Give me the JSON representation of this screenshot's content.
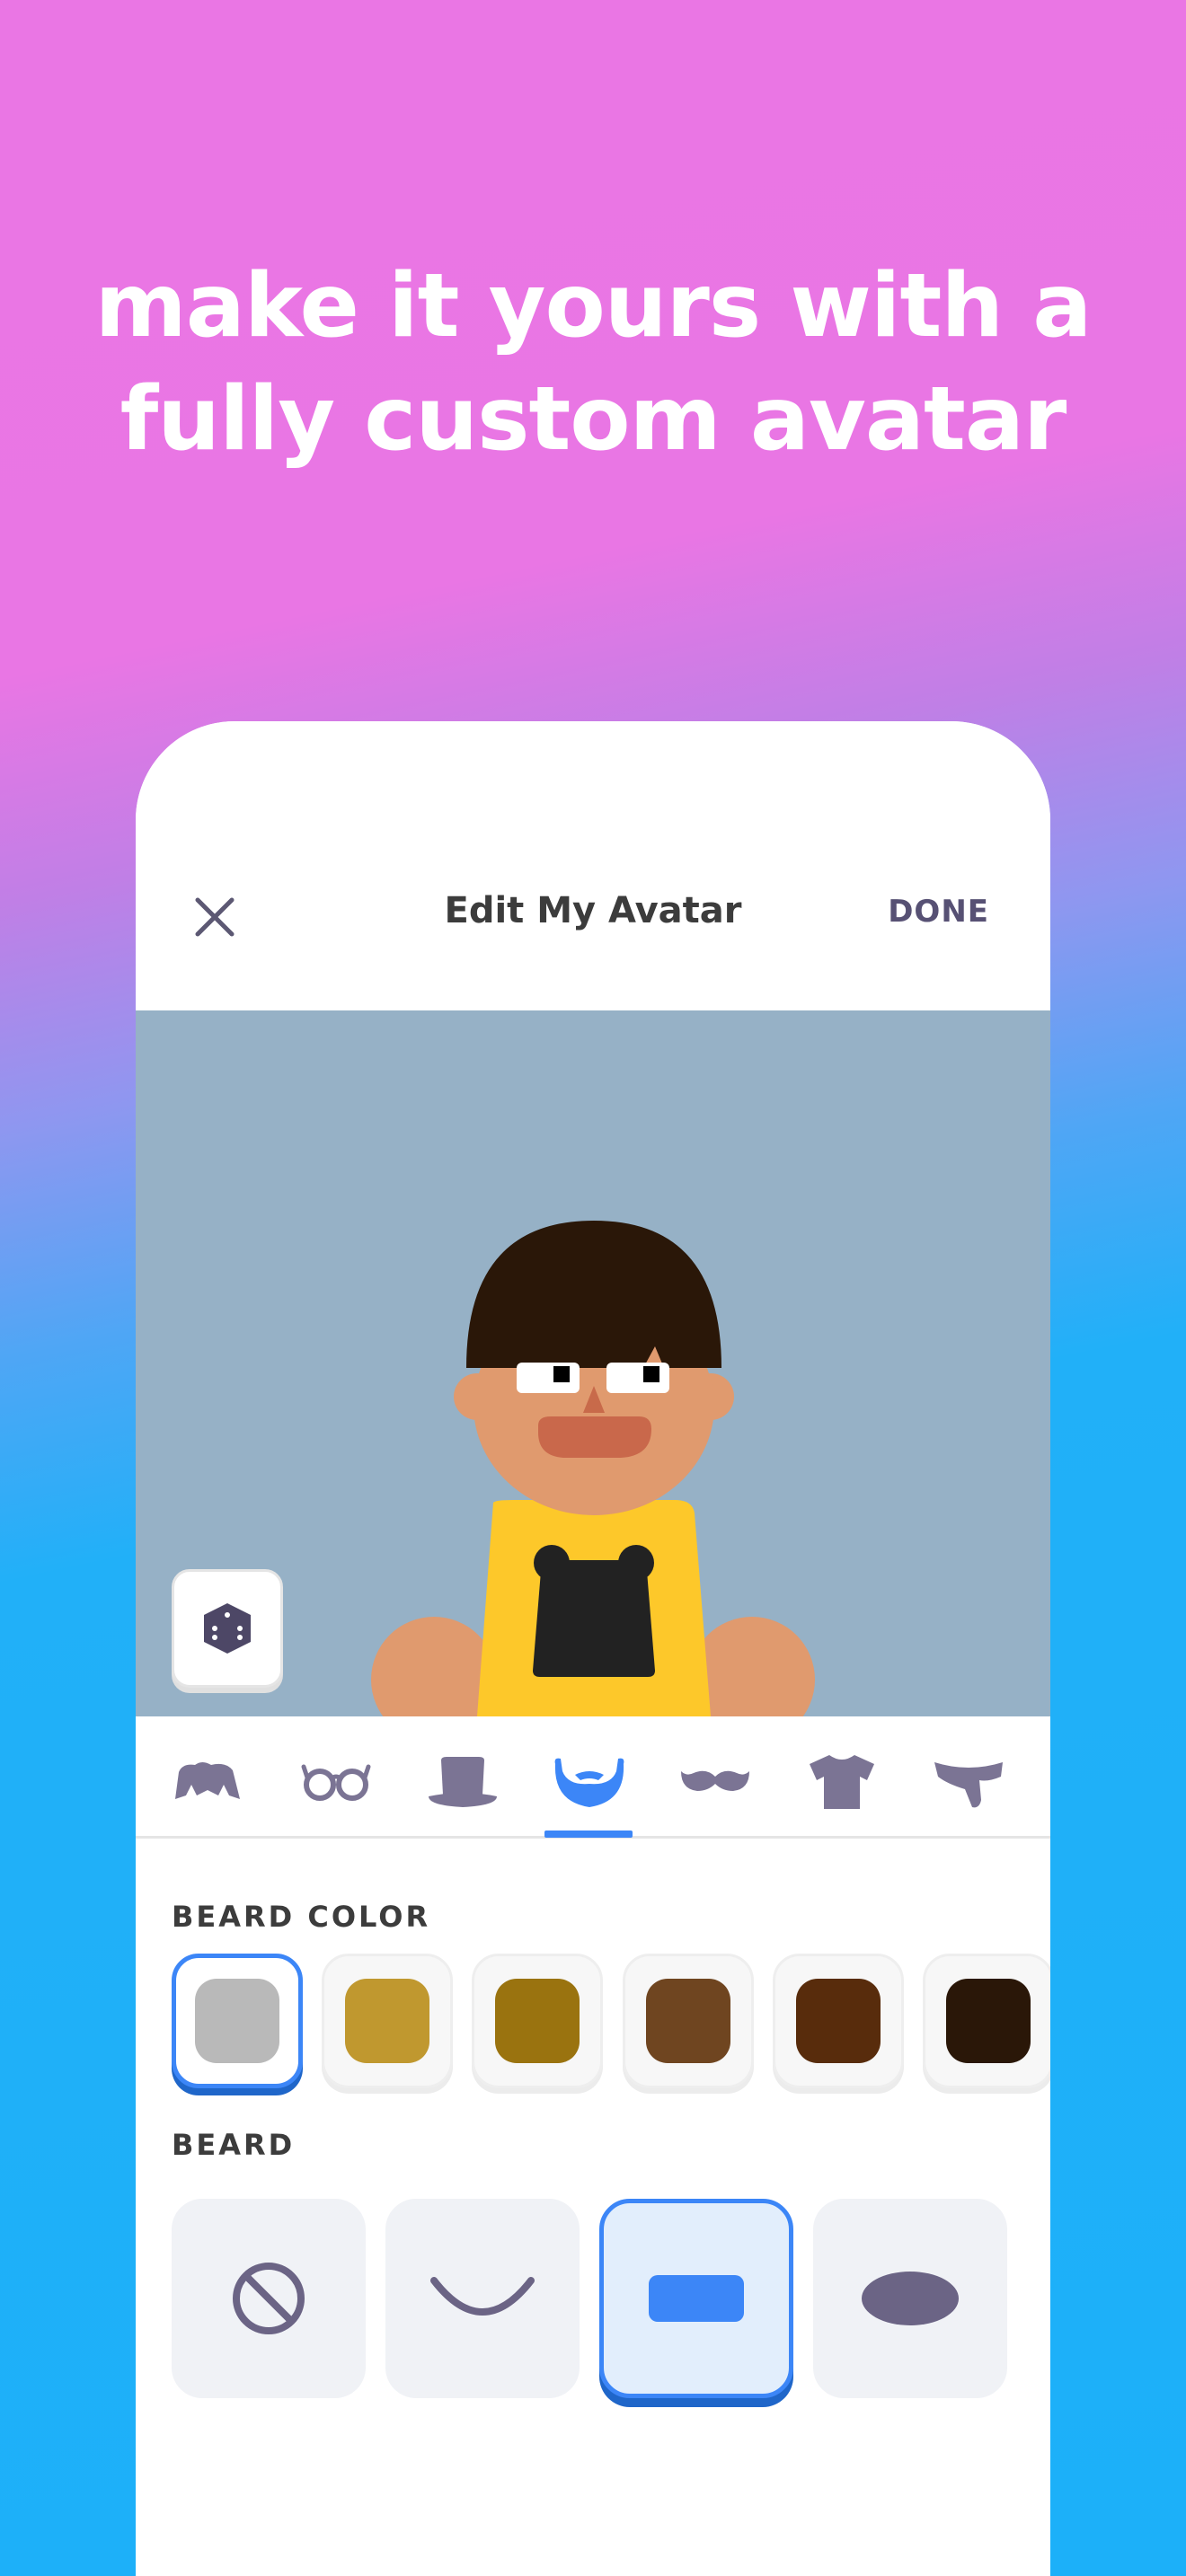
{
  "promo": {
    "line1": "make it yours with a",
    "line2": "fully custom avatar"
  },
  "header": {
    "title": "Edit My Avatar",
    "done_label": "DONE",
    "close_icon": "close-icon"
  },
  "tabs": [
    {
      "name": "hair",
      "icon": "hair-icon"
    },
    {
      "name": "glasses",
      "icon": "glasses-icon"
    },
    {
      "name": "hat",
      "icon": "hat-icon"
    },
    {
      "name": "beard",
      "icon": "beard-icon",
      "selected": true
    },
    {
      "name": "mustache",
      "icon": "mustache-icon"
    },
    {
      "name": "shirt",
      "icon": "shirt-icon"
    },
    {
      "name": "scarf",
      "icon": "scarf-icon"
    }
  ],
  "beard_color": {
    "label": "BEARD COLOR",
    "swatches": [
      "#b9b9b9",
      "#c0982f",
      "#9a730f",
      "#6f4520",
      "#582c0c",
      "#2a1708"
    ],
    "selected_index": 0
  },
  "beard": {
    "label": "BEARD",
    "styles": [
      "none",
      "chinstrap",
      "goatee",
      "full"
    ],
    "selected_index": 2
  },
  "colors": {
    "accent": "#3c86f7",
    "icon": "#7b7494",
    "stage_bg": "#96b1c6"
  }
}
